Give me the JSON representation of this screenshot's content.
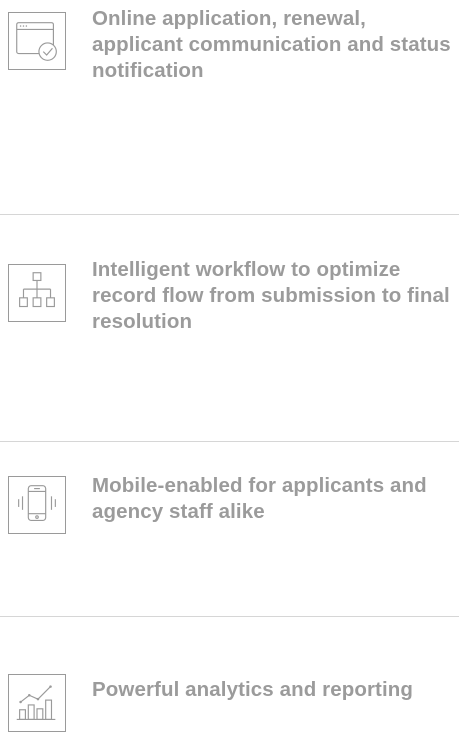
{
  "features": [
    {
      "icon": "browser-checkmark-icon",
      "text": "Online application, renewal, applicant communication and status notification"
    },
    {
      "icon": "workflow-hierarchy-icon",
      "text": "Intelligent workflow to optimize record flow from submission to final resolution"
    },
    {
      "icon": "mobile-phone-icon",
      "text": "Mobile-enabled for applicants and agency staff alike"
    },
    {
      "icon": "analytics-chart-icon",
      "text": "Powerful analytics and reporting"
    }
  ],
  "colors": {
    "text": "#9b9b9b",
    "icon_stroke": "#9a9a9a",
    "divider": "#d6d6d6"
  }
}
